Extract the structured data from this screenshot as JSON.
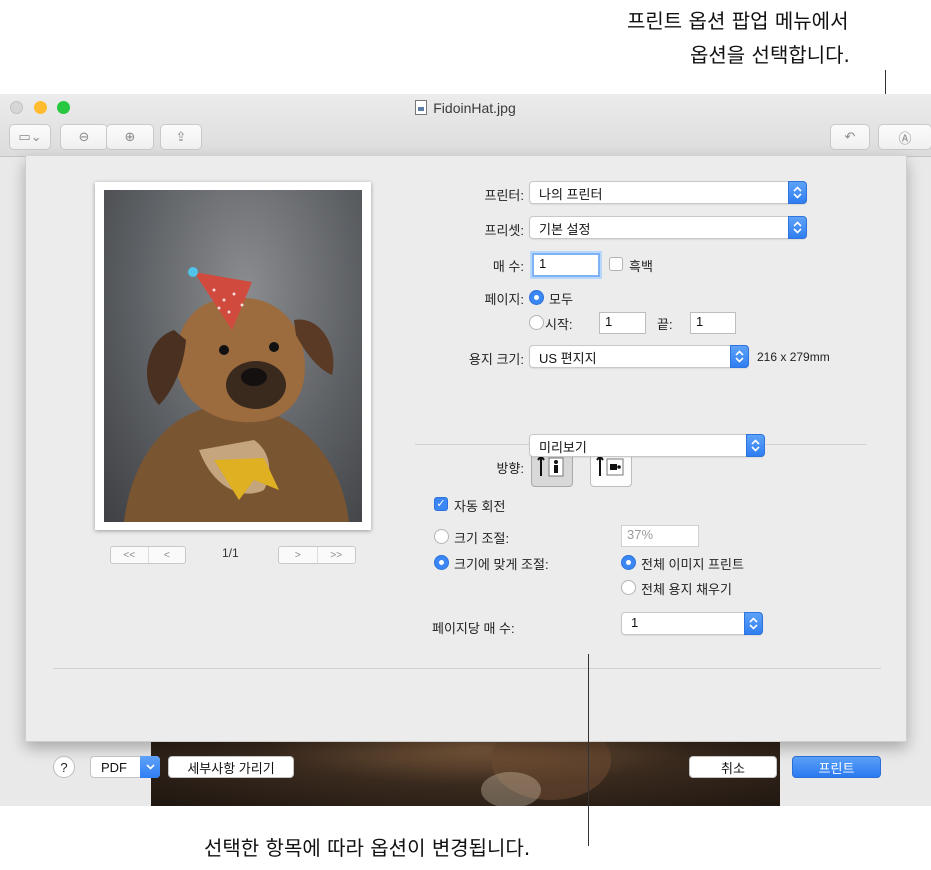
{
  "callouts": {
    "top_line1": "프린트 옵션 팝업 메뉴에서",
    "top_line2": "옵션을 선택합니다.",
    "bottom": "선택한 항목에 따라 옵션이 변경됩니다."
  },
  "window": {
    "title": "FidoinHat.jpg",
    "toolbar": {
      "sidebar_icon": "sidebar-icon",
      "zoom_out_icon": "zoom-out-icon",
      "zoom_in_icon": "zoom-in-icon",
      "share_icon": "share-icon",
      "rotate_icon": "rotate-icon",
      "markup_icon": "markup-icon"
    }
  },
  "print": {
    "pager": {
      "first": "<<",
      "prev": "<",
      "page": "1/1",
      "next": ">",
      "last": ">>"
    },
    "printer": {
      "label": "프린터:",
      "value": "나의 프린터"
    },
    "preset": {
      "label": "프리셋:",
      "value": "기본 설정"
    },
    "copies": {
      "label": "매 수:",
      "value": "1",
      "bw_label": "흑백"
    },
    "pages": {
      "label": "페이지:",
      "all": "모두",
      "from": "시작:",
      "from_value": "1",
      "to": "끝:",
      "to_value": "1"
    },
    "paper": {
      "label": "용지 크기:",
      "value": "US 편지지",
      "dims": "216 x 279mm"
    },
    "orientation": {
      "label": "방향:"
    },
    "options_menu": {
      "value": "미리보기"
    },
    "auto_rotate": "자동 회전",
    "scale": {
      "label": "크기 조절:",
      "value": "37%"
    },
    "fit": {
      "label": "크기에 맞게 조절:",
      "print_entire": "전체 이미지 프린트",
      "fill_paper": "전체 용지 채우기"
    },
    "per_page": {
      "label": "페이지당 매 수:",
      "value": "1"
    },
    "footer": {
      "help": "?",
      "pdf": "PDF",
      "hide_details": "세부사항 가리기",
      "cancel": "취소",
      "print": "프린트"
    }
  },
  "colors": {
    "accent": "#3b87f5",
    "close": "#ff5f57",
    "minimize": "#febc2e",
    "zoom": "#28c840"
  }
}
